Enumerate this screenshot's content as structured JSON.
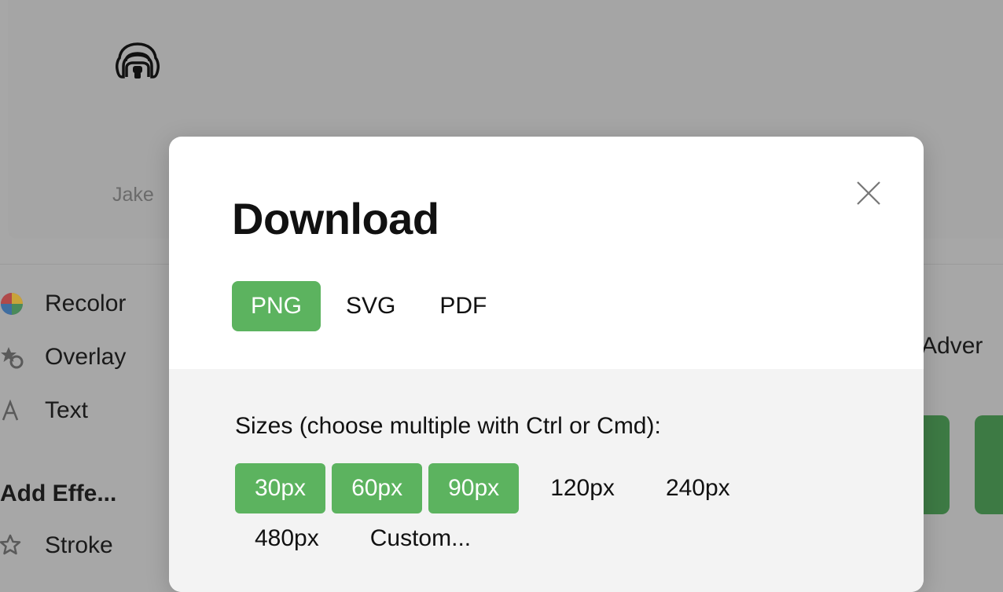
{
  "background": {
    "icon_name": "Jake",
    "menu": [
      {
        "label": "Recolor",
        "icon": "color-wheel-icon"
      },
      {
        "label": "Overlay",
        "icon": "overlay-icon"
      },
      {
        "label": "Text",
        "icon": "text-icon"
      }
    ],
    "effects_heading": "Add Effe...",
    "effects": [
      {
        "label": "Stroke",
        "icon": "star-outline-icon"
      }
    ],
    "advanced_label": "Adver"
  },
  "modal": {
    "title": "Download",
    "formats": [
      "PNG",
      "SVG",
      "PDF"
    ],
    "selected_format": "PNG",
    "sizes_label": "Sizes (choose multiple with Ctrl or Cmd):",
    "sizes": [
      {
        "label": "30px",
        "selected": true
      },
      {
        "label": "60px",
        "selected": true
      },
      {
        "label": "90px",
        "selected": true
      },
      {
        "label": "120px",
        "selected": false
      },
      {
        "label": "240px",
        "selected": false
      },
      {
        "label": "480px",
        "selected": false
      },
      {
        "label": "Custom...",
        "selected": false
      }
    ]
  },
  "colors": {
    "accent": "#5cb35f",
    "overlay": "#a7a7a7",
    "options_bg": "#f3f3f3"
  }
}
